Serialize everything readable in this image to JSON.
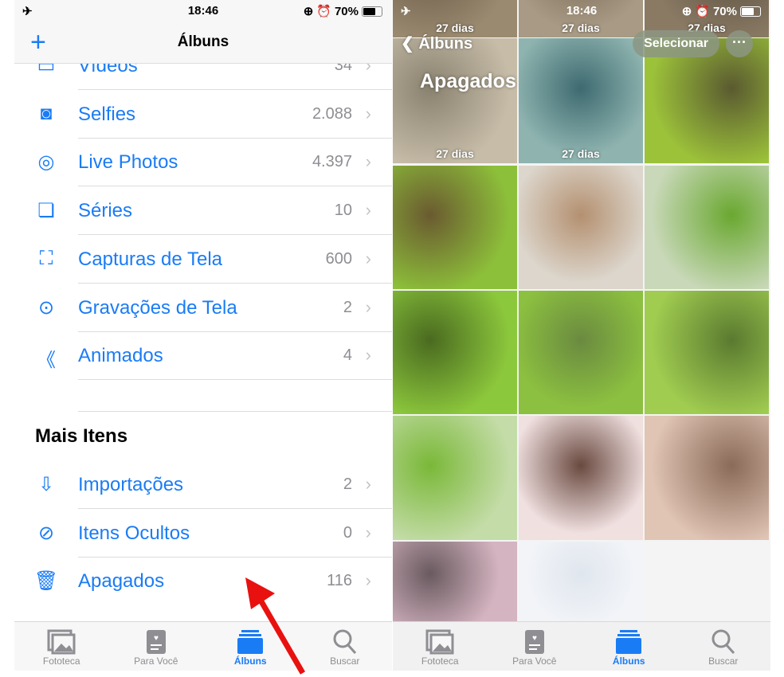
{
  "status": {
    "time": "18:46",
    "battery": "70%",
    "battery_level": 0.7
  },
  "left": {
    "title": "Álbuns",
    "media_types": [
      {
        "label": "Vídeos",
        "count": "34",
        "icon": "video-icon"
      },
      {
        "label": "Selfies",
        "count": "2.088",
        "icon": "selfie-icon"
      },
      {
        "label": "Live Photos",
        "count": "4.397",
        "icon": "live-photo-icon"
      },
      {
        "label": "Séries",
        "count": "10",
        "icon": "burst-icon"
      },
      {
        "label": "Capturas de Tela",
        "count": "600",
        "icon": "screenshot-icon"
      },
      {
        "label": "Gravações de Tela",
        "count": "2",
        "icon": "screen-record-icon"
      },
      {
        "label": "Animados",
        "count": "4",
        "icon": "animated-icon"
      }
    ],
    "section_title": "Mais Itens",
    "more_items": [
      {
        "label": "Importações",
        "count": "2",
        "icon": "import-icon"
      },
      {
        "label": "Itens Ocultos",
        "count": "0",
        "icon": "hidden-eye-icon"
      },
      {
        "label": "Apagados",
        "count": "116",
        "icon": "trash-icon"
      }
    ]
  },
  "right": {
    "back_label": "Álbuns",
    "select_label": "Selecionar",
    "title": "Apagados",
    "days_label": "27 dias"
  },
  "tabs": [
    {
      "label": "Fototeca",
      "icon": "photo-library-icon"
    },
    {
      "label": "Para Você",
      "icon": "for-you-icon"
    },
    {
      "label": "Álbuns",
      "icon": "albums-icon",
      "active": true
    },
    {
      "label": "Buscar",
      "icon": "search-icon"
    }
  ],
  "colors": {
    "accent": "#1a7cf5",
    "annotation_arrow": "#e8110f"
  }
}
